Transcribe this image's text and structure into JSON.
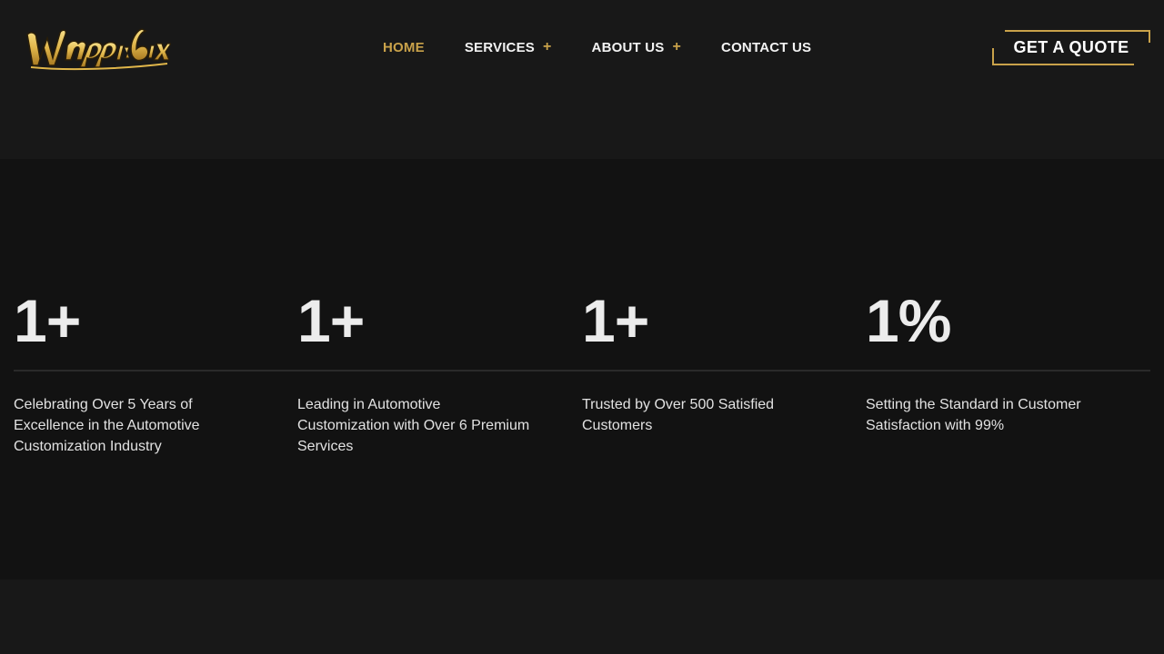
{
  "header": {
    "logo_text": "Wraps in 6ix",
    "nav": [
      {
        "label": "HOME",
        "active": true,
        "has_submenu": false
      },
      {
        "label": "SERVICES",
        "active": false,
        "has_submenu": true
      },
      {
        "label": "ABOUT US",
        "active": false,
        "has_submenu": true
      },
      {
        "label": "CONTACT US",
        "active": false,
        "has_submenu": false
      }
    ],
    "submenu_symbol": "+",
    "cta_label": "GET A QUOTE"
  },
  "stats": [
    {
      "value": "1+",
      "description": "Celebrating Over 5 Years of Excellence in the Automotive Customization Industry"
    },
    {
      "value": "1+",
      "description": "Leading in Automotive Customization with Over 6 Premium Services"
    },
    {
      "value": "1+",
      "description": "Trusted by Over 500 Satisfied Customers"
    },
    {
      "value": "1%",
      "description": "Setting the Standard in Customer Satisfaction with 99%"
    }
  ],
  "colors": {
    "accent": "#c9a24a",
    "background": "#181818",
    "stats_background": "#121212",
    "text": "#f2f2f2"
  }
}
